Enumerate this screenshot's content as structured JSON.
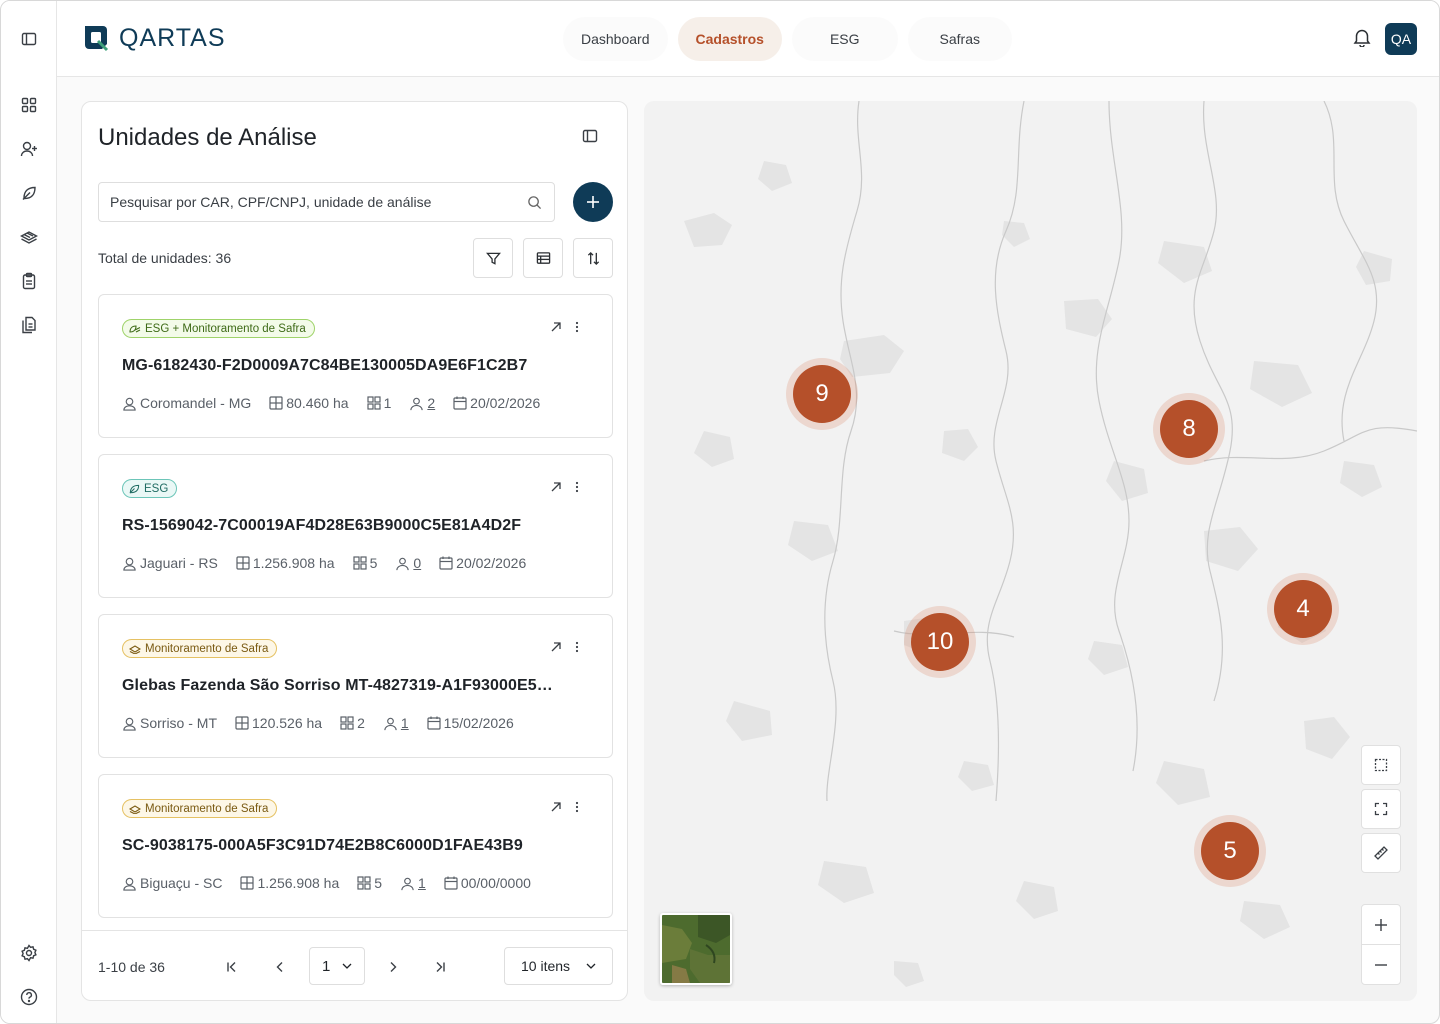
{
  "app": {
    "logo_text": "QARTAS",
    "avatar_initials": "QA"
  },
  "nav": {
    "tabs": [
      {
        "label": "Dashboard",
        "active": false
      },
      {
        "label": "Cadastros",
        "active": true
      },
      {
        "label": "ESG",
        "active": false
      },
      {
        "label": "Safras",
        "active": false
      }
    ]
  },
  "panel": {
    "title": "Unidades de Análise",
    "search_placeholder": "Pesquisar por CAR, CPF/CNPJ, unidade de análise",
    "total_label": "Total de unidades: 36"
  },
  "cards": [
    {
      "tag": "ESG + Monitoramento de Safra",
      "tag_type": "esgmon",
      "title": "MG-6182430-F2D0009A7C84BE130005DA9E6F1C2B7",
      "location": "Coromandel - MG",
      "area": "80.460 ha",
      "units": "1",
      "people": "2",
      "date": "20/02/2026"
    },
    {
      "tag": "ESG",
      "tag_type": "esg",
      "title": "RS-1569042-7C00019AF4D28E63B9000C5E81A4D2F",
      "location": "Jaguari - RS",
      "area": "1.256.908 ha",
      "units": "5",
      "people": "0",
      "date": "20/02/2026"
    },
    {
      "tag": "Monitoramento de Safra",
      "tag_type": "mon",
      "title": "Glebas Fazenda São Sorriso MT-4827319-A1F93000E5B...",
      "location": "Sorriso - MT",
      "area": "120.526 ha",
      "units": "2",
      "people": "1",
      "date": "15/02/2026"
    },
    {
      "tag": "Monitoramento de Safra",
      "tag_type": "mon",
      "title": "SC-9038175-000A5F3C91D74E2B8C6000D1FAE43B9",
      "location": "Biguaçu - SC",
      "area": "1.256.908 ha",
      "units": "5",
      "people": "1",
      "date": "00/00/0000"
    }
  ],
  "pagination": {
    "range": "1-10 de 36",
    "current_page": "1",
    "page_size": "10 itens"
  },
  "map": {
    "clusters": [
      "9",
      "8",
      "10",
      "4",
      "5"
    ]
  },
  "colors": {
    "brand": "#0f3b57",
    "accent": "#b5502a"
  }
}
